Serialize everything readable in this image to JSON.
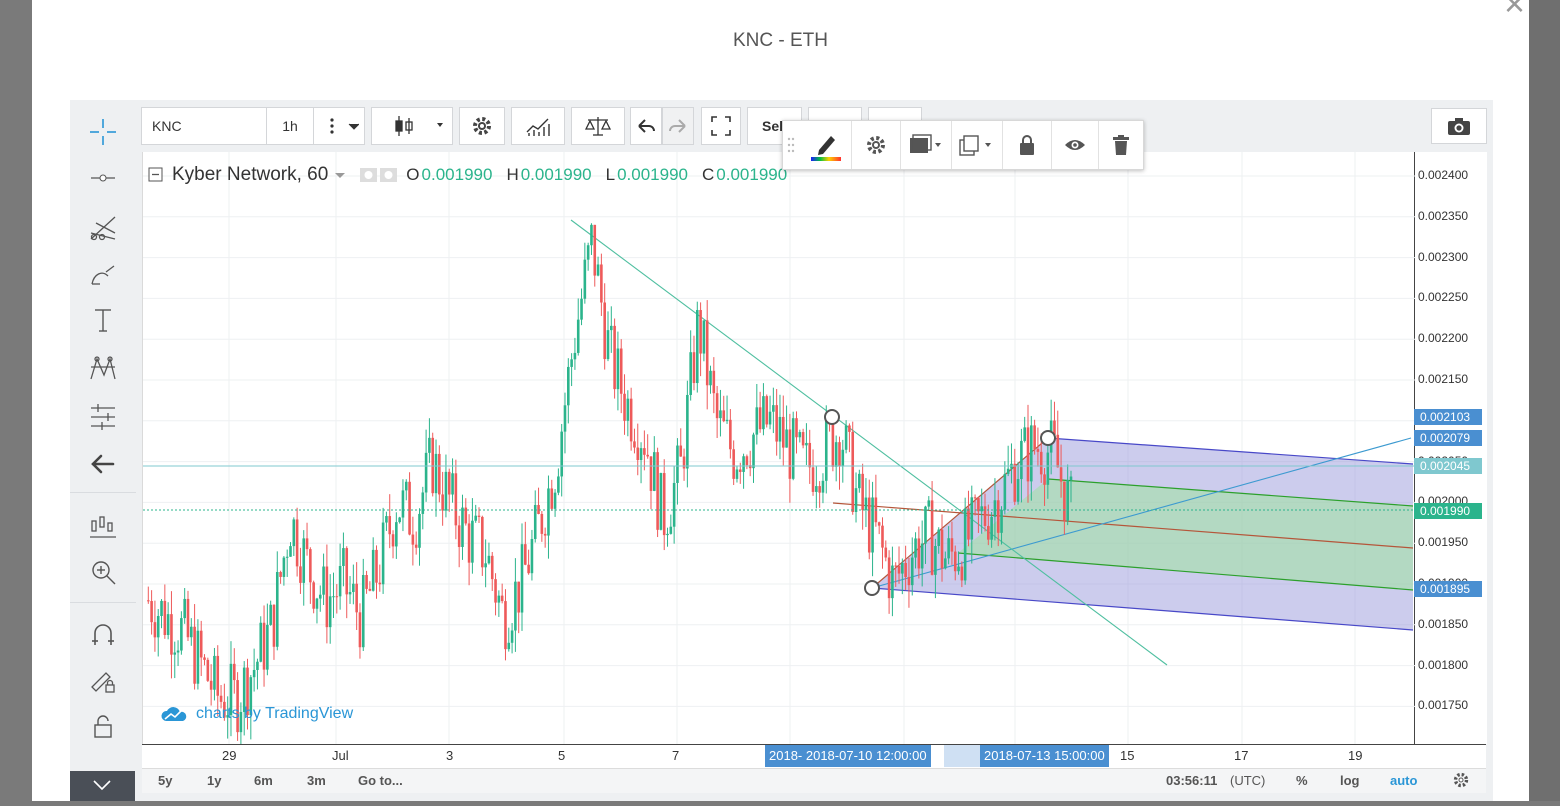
{
  "modal": {
    "title": "KNC - ETH",
    "close_icon": "close-icon"
  },
  "toolbar": {
    "symbol": "KNC",
    "interval": "1h",
    "sell_label": "Sell",
    "icons": [
      "more-vert-icon",
      "chevron-down-icon",
      "candles-icon",
      "settings-icon",
      "indicators-icon",
      "compare-icon",
      "undo-icon",
      "redo-icon",
      "fullscreen-icon",
      "camera-icon"
    ]
  },
  "legend": {
    "name": "Kyber Network, 60",
    "o_label": "O",
    "o": "0.001990",
    "h_label": "H",
    "h": "0.001990",
    "l_label": "L",
    "l": "0.001990",
    "c_label": "C",
    "c": "0.001990",
    "value_color": "#2bb48c"
  },
  "price_axis": {
    "ticks": [
      "0.002400",
      "0.002350",
      "0.002300",
      "0.002250",
      "0.002200",
      "0.002150",
      "0.002100",
      "0.002050",
      "0.002000",
      "0.001950",
      "0.001900",
      "0.001850",
      "0.001800",
      "0.001750"
    ],
    "badges": [
      {
        "value": "0.002103",
        "color": "#4a8fd1"
      },
      {
        "value": "0.002079",
        "color": "#4a8fd1"
      },
      {
        "value": "0.002045",
        "color": "#7fc8cf"
      },
      {
        "value": "0.001990",
        "color": "#2bb48c"
      },
      {
        "value": "0.001895",
        "color": "#4a8fd1"
      }
    ]
  },
  "time_axis": {
    "ticks": [
      "29",
      "Jul",
      "3",
      "5",
      "7",
      "15",
      "17",
      "19"
    ],
    "badges": [
      "2018- 2018-07-10 12:00:00",
      "2018-07-13 15:00:00"
    ]
  },
  "bottom_bar": {
    "ranges": [
      "5y",
      "1y",
      "6m",
      "3m",
      "Go to..."
    ],
    "clock": "03:56:11",
    "tz": "(UTC)",
    "pct": "%",
    "log": "log",
    "auto": "auto"
  },
  "watermark": "charts by TradingView",
  "colors": {
    "up": "#2bb48c",
    "down": "#ee5a5a",
    "pitchfork_blue": "#8d8fd8",
    "pitchfork_green": "#9fe39f",
    "accent": "#2a96d6"
  },
  "chart_data": {
    "type": "candlestick",
    "symbol": "Kyber Network",
    "interval": "60",
    "ylim": [
      0.00171,
      0.00241
    ],
    "x_ticks": [
      "29",
      "Jul",
      "3",
      "5",
      "7",
      "15",
      "17",
      "19"
    ],
    "y_ticks": [
      0.0024,
      0.00235,
      0.0023,
      0.00225,
      0.0022,
      0.00215,
      0.0021,
      0.00205,
      0.002,
      0.00195,
      0.0019,
      0.00185,
      0.0018,
      0.00175
    ],
    "close_series_approx": [
      0.00188,
      0.00186,
      0.00184,
      0.0018,
      0.00176,
      0.00176,
      0.0018,
      0.00185,
      0.00198,
      0.00192,
      0.00188,
      0.0019,
      0.00186,
      0.00192,
      0.002,
      0.00198,
      0.00205,
      0.002,
      0.00196,
      0.00194,
      0.00186,
      0.0019,
      0.00197,
      0.00205,
      0.0022,
      0.00232,
      0.00218,
      0.00212,
      0.00208,
      0.00198,
      0.00204,
      0.00222,
      0.0021,
      0.00206,
      0.00208,
      0.0021,
      0.00207,
      0.00204,
      0.00206,
      0.00209,
      0.002,
      0.00196,
      0.0019,
      0.00194,
      0.00196,
      0.00193,
      0.00195,
      0.00198,
      0.00201,
      0.00205,
      0.00207,
      0.00206,
      0.00199
    ]
  }
}
